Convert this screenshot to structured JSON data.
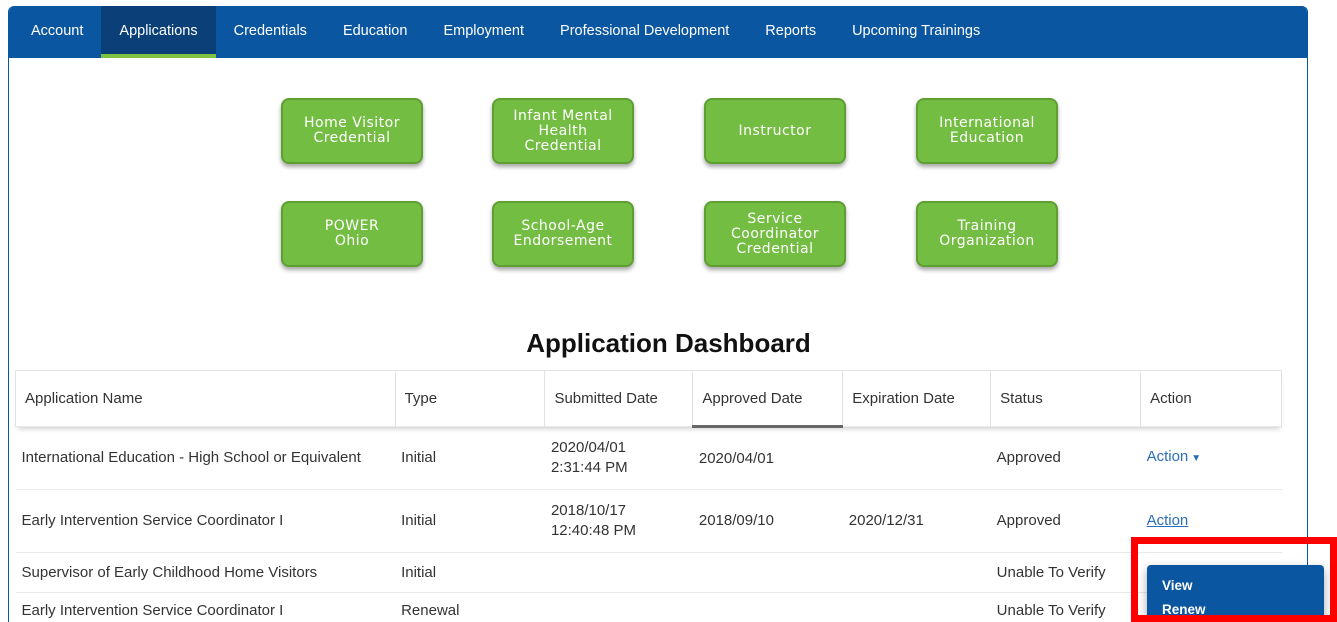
{
  "nav": {
    "items": [
      {
        "label": "Account"
      },
      {
        "label": "Applications"
      },
      {
        "label": "Credentials"
      },
      {
        "label": "Education"
      },
      {
        "label": "Employment"
      },
      {
        "label": "Professional Development"
      },
      {
        "label": "Reports"
      },
      {
        "label": "Upcoming Trainings"
      }
    ],
    "active": "Applications"
  },
  "app_buttons": [
    {
      "label": "Home Visitor\nCredential"
    },
    {
      "label": "Infant Mental\nHealth\nCredential"
    },
    {
      "label": "Instructor"
    },
    {
      "label": "International\nEducation"
    },
    {
      "label": "POWER\nOhio"
    },
    {
      "label": "School-Age\nEndorsement"
    },
    {
      "label": "Service\nCoordinator\nCredential"
    },
    {
      "label": "Training\nOrganization"
    }
  ],
  "dashboard": {
    "title": "Application Dashboard",
    "columns": [
      "Application Name",
      "Type",
      "Submitted Date",
      "Approved Date",
      "Expiration Date",
      "Status",
      "Action"
    ],
    "rows": [
      {
        "name": "International Education - High School or Equivalent",
        "type": "Initial",
        "submitted_date": "2020/04/01",
        "submitted_time": "2:31:44 PM",
        "approved": "2020/04/01",
        "expiration": "",
        "status": "Approved",
        "action": "Action"
      },
      {
        "name": "Early Intervention Service Coordinator I",
        "type": "Initial",
        "submitted_date": "2018/10/17",
        "submitted_time": "12:40:48 PM",
        "approved": "2018/09/10",
        "expiration": "2020/12/31",
        "status": "Approved",
        "action": "Action"
      },
      {
        "name": "Supervisor of Early Childhood Home Visitors",
        "type": "Initial",
        "submitted_date": "",
        "submitted_time": "",
        "approved": "",
        "expiration": "",
        "status": "Unable To Verify",
        "action": ""
      },
      {
        "name": "Early Intervention Service Coordinator I",
        "type": "Renewal",
        "submitted_date": "",
        "submitted_time": "",
        "approved": "",
        "expiration": "",
        "status": "Unable To Verify",
        "action": ""
      }
    ]
  },
  "action_menu": {
    "items": [
      "View",
      "Renew"
    ]
  },
  "colors": {
    "nav_bg": "#0b56a0",
    "nav_active_bg": "#0a3f78",
    "nav_active_underline": "#7fc241",
    "button_green": "#74bd43",
    "link_blue": "#2a6ebb",
    "highlight_red": "#ff0000"
  },
  "icons": {
    "action_caret": "caret-down-icon"
  }
}
